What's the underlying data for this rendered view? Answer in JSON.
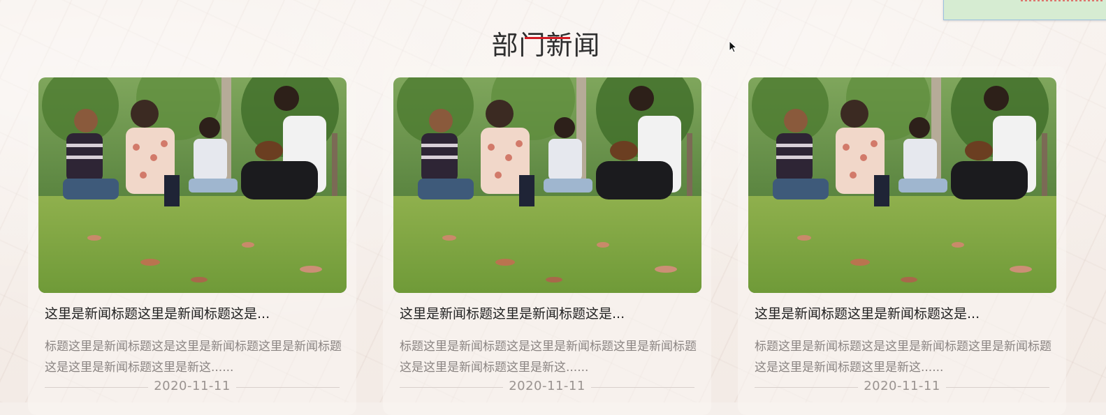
{
  "section": {
    "title": "部门新闻"
  },
  "colors": {
    "accent": "#d21c24",
    "title_text": "#222222",
    "summary_text": "#8a8482",
    "date_text": "#9a9390"
  },
  "news": [
    {
      "image": "photo-friends-on-lawn",
      "title": "这里是新闻标题这里是新闻标题这是...",
      "summary": "标题这里是新闻标题这是这里是新闻标题这里是新闻标题这是这里是新闻标题这里是新这......",
      "date": "2020-11-11"
    },
    {
      "image": "photo-friends-on-lawn",
      "title": "这里是新闻标题这里是新闻标题这是...",
      "summary": "标题这里是新闻标题这是这里是新闻标题这里是新闻标题这是这里是新闻标题这里是新这......",
      "date": "2020-11-11"
    },
    {
      "image": "photo-friends-on-lawn",
      "title": "这里是新闻标题这里是新闻标题这是...",
      "summary": "标题这里是新闻标题这是这里是新闻标题这里是新闻标题这是这里是新闻标题这里是新这......",
      "date": "2020-11-11"
    }
  ]
}
